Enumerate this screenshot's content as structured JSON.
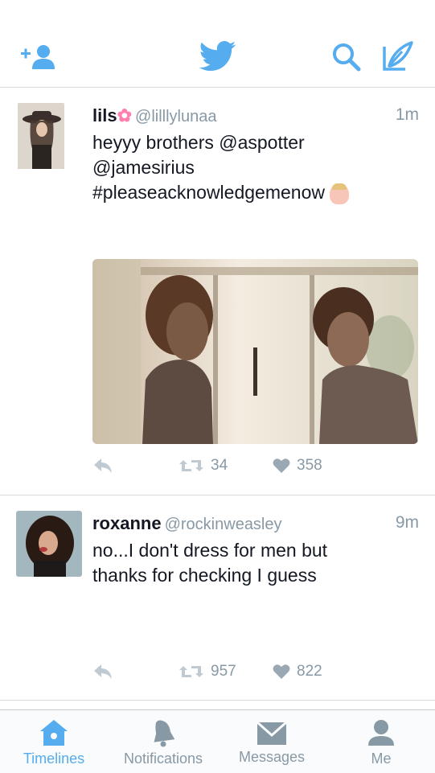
{
  "tweets": [
    {
      "name": "lils",
      "handle": "@lilllylunaa",
      "time": "1m",
      "lines": [
        "heyyy brothers @aspotter",
        "@jamesirius",
        "#pleaseacknowledgemenow"
      ],
      "retweets": "34",
      "likes": "358"
    },
    {
      "name": "roxanne",
      "handle": "@rockinweasley",
      "time": "9m",
      "lines": [
        "no...I don't dress for men but",
        "thanks for checking I guess"
      ],
      "retweets": "957",
      "likes": "822"
    }
  ],
  "tabs": [
    {
      "label": "Timelines"
    },
    {
      "label": "Notifications"
    },
    {
      "label": "Messages"
    },
    {
      "label": "Me"
    }
  ],
  "colors": {
    "accent": "#55acee",
    "muted": "#8899a6",
    "text": "#141823",
    "divider": "#d6dbe0"
  },
  "icons": [
    "add-user-icon",
    "twitter-bird-icon",
    "search-icon",
    "compose-icon",
    "reply-icon",
    "retweet-icon",
    "heart-icon",
    "home-icon",
    "bell-icon",
    "envelope-icon",
    "person-icon"
  ]
}
